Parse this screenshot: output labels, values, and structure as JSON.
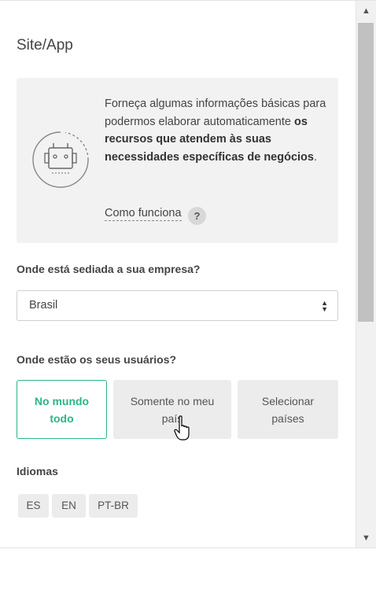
{
  "panel": {
    "section_title": "Site/App"
  },
  "info_box": {
    "text_part1": "Forneça algumas informações básicas para podermos elaborar automaticamente ",
    "text_bold": "os recursos que atendem às suas necessidades específicas de negócios",
    "text_part2": ".",
    "how_link": "Como funciona",
    "help_badge": "?",
    "icon": "robot-icon"
  },
  "company_location": {
    "question": "Onde está sediada a sua empresa?",
    "selected_value": "Brasil"
  },
  "users_location": {
    "question": "Onde estão os seus usuários?",
    "options": [
      {
        "label_line1": "No mundo",
        "label_line2": "todo",
        "selected": true
      },
      {
        "label_line1": "Somente no meu",
        "label_line2": "país",
        "selected": false
      },
      {
        "label_line1": "Selecionar",
        "label_line2": "países",
        "selected": false
      }
    ]
  },
  "languages": {
    "label": "Idiomas",
    "chips": [
      "ES",
      "EN",
      "PT-BR"
    ]
  },
  "colors": {
    "accent": "#2ab58a",
    "box_bg": "#f2f2f2"
  }
}
